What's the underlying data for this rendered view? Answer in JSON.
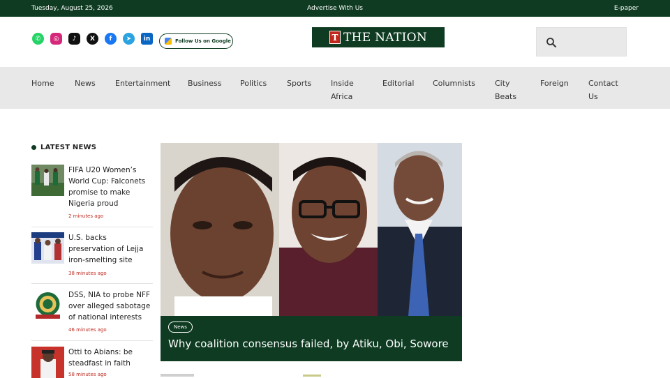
{
  "topbar": {
    "date": "Tuesday, August 25, 2026",
    "advertise": "Advertise With Us",
    "epaper": "E-paper"
  },
  "header": {
    "google_button": "Follow Us on Google",
    "logo_text": "THE NATION",
    "logo_mark": "T",
    "social_icons": [
      "whatsapp-icon",
      "instagram-icon",
      "tiktok-icon",
      "x-icon",
      "facebook-icon",
      "telegram-icon",
      "linkedin-icon"
    ]
  },
  "nav": {
    "items": [
      {
        "label": "Home"
      },
      {
        "label": "News"
      },
      {
        "label": "Entertainment"
      },
      {
        "label": "Business"
      },
      {
        "label": "Politics"
      },
      {
        "label": "Sports"
      },
      {
        "label": "Inside Africa"
      },
      {
        "label": "Editorial"
      },
      {
        "label": "Columnists"
      },
      {
        "label": "City Beats"
      },
      {
        "label": "Foreign"
      },
      {
        "label": "Contact Us"
      }
    ]
  },
  "latest": {
    "heading": "LATEST NEWS",
    "items": [
      {
        "title": "FIFA U20 Women’s World Cup: Falconets promise to make Nigeria proud",
        "time": "2 minutes ago"
      },
      {
        "title": "U.S. backs preservation of Lejja iron-smelting site",
        "time": "38 minutes ago"
      },
      {
        "title": "DSS, NIA to probe NFF over alleged sabotage of national interests",
        "time": "46 minutes ago"
      },
      {
        "title": "Otti to Abians: be steadfast in faith",
        "time": "58 minutes ago"
      }
    ]
  },
  "hero": {
    "tag": "News",
    "title": "Why coalition consensus failed, by Atiku, Obi, Sowore"
  },
  "colors": {
    "brand_green": "#0e3b21",
    "accent_red": "#c0281e",
    "nav_bg": "#e8e8e8"
  }
}
